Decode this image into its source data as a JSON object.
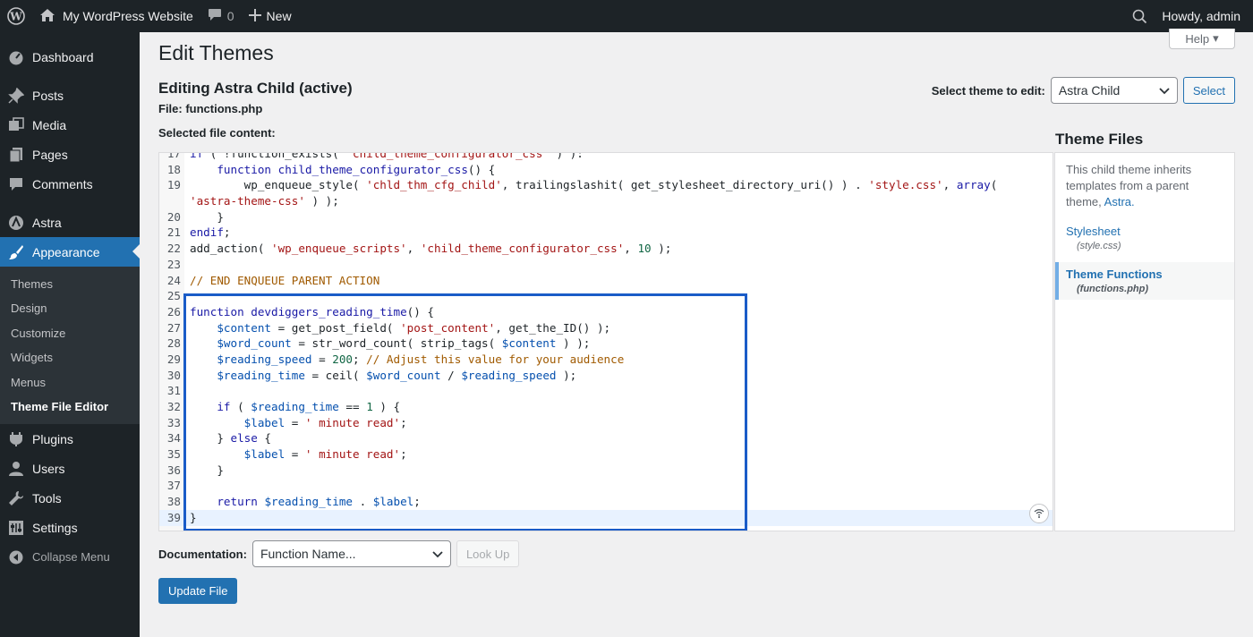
{
  "adminbar": {
    "site_name": "My WordPress Website",
    "comments_count": "0",
    "new_label": "New",
    "howdy": "Howdy, admin"
  },
  "sidebar": {
    "items": [
      {
        "label": "Dashboard",
        "icon": "dashboard-icon"
      },
      {
        "label": "Posts",
        "icon": "pin-icon"
      },
      {
        "label": "Media",
        "icon": "media-icon"
      },
      {
        "label": "Pages",
        "icon": "page-icon"
      },
      {
        "label": "Comments",
        "icon": "comment-icon"
      },
      {
        "label": "Astra",
        "icon": "astra-icon"
      },
      {
        "label": "Appearance",
        "icon": "brush-icon"
      }
    ],
    "submenu": [
      "Themes",
      "Design",
      "Customize",
      "Widgets",
      "Menus",
      "Theme File Editor"
    ],
    "lower": [
      {
        "label": "Plugins",
        "icon": "plugin-icon"
      },
      {
        "label": "Users",
        "icon": "user-icon"
      },
      {
        "label": "Tools",
        "icon": "wrench-icon"
      },
      {
        "label": "Settings",
        "icon": "settings-icon"
      }
    ],
    "collapse": "Collapse Menu"
  },
  "header": {
    "help": "Help",
    "title": "Edit Themes",
    "editing": "Editing Astra Child (active)",
    "file": "File: functions.php",
    "selected_content": "Selected file content:",
    "select_theme_label": "Select theme to edit:",
    "select_theme_value": "Astra Child",
    "select_button": "Select"
  },
  "code": {
    "highlight_color": "#1a5cc8"
  },
  "theme_files": {
    "title": "Theme Files",
    "inherit_text": "This child theme inherits templates from a parent theme,",
    "parent_link": "Astra.",
    "files": [
      {
        "name": "Stylesheet",
        "path": "(style.css)"
      },
      {
        "name": "Theme Functions",
        "path": "(functions.php)"
      }
    ]
  },
  "footer": {
    "doc_label": "Documentation:",
    "doc_select": "Function Name...",
    "lookup": "Look Up",
    "update": "Update File"
  },
  "colors": {
    "adminbar_bg": "#1d2327",
    "accent": "#2271b1"
  }
}
